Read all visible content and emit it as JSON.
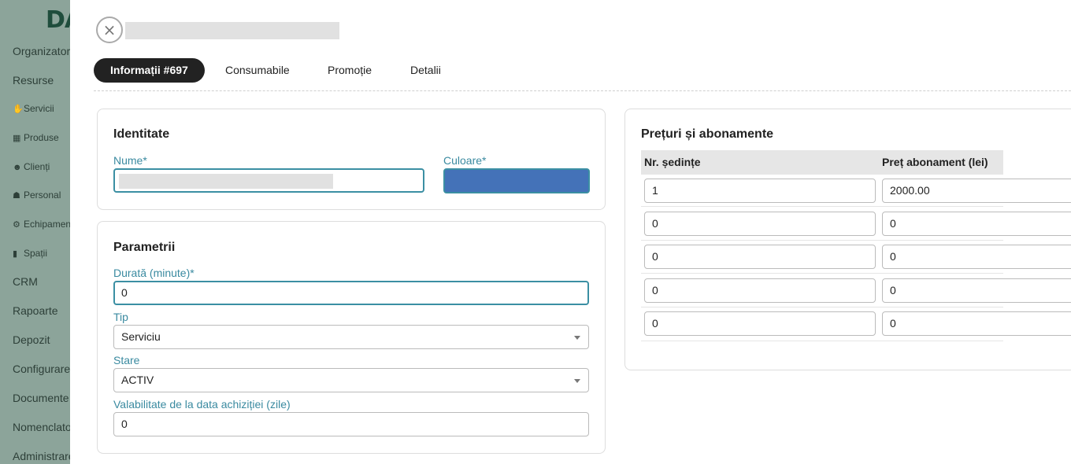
{
  "background_sidebar": {
    "logo": "DA",
    "items": [
      {
        "label": "Organizator",
        "icon": ""
      },
      {
        "label": "Resurse",
        "icon": ""
      },
      {
        "label": "Servicii",
        "icon": "hand-icon"
      },
      {
        "label": "Produse",
        "icon": "boxes-icon"
      },
      {
        "label": "Clienți",
        "icon": "users-icon"
      },
      {
        "label": "Personal",
        "icon": "staff-icon"
      },
      {
        "label": "Echipamente",
        "icon": "equipment-icon"
      },
      {
        "label": "Spații",
        "icon": "door-icon"
      },
      {
        "label": "CRM",
        "icon": ""
      },
      {
        "label": "Rapoarte",
        "icon": ""
      },
      {
        "label": "Depozit",
        "icon": ""
      },
      {
        "label": "Configurare",
        "icon": ""
      },
      {
        "label": "Documente",
        "icon": ""
      },
      {
        "label": "Nomenclatoare",
        "icon": ""
      },
      {
        "label": "Administrare",
        "icon": ""
      }
    ]
  },
  "modal": {
    "close_icon": "×",
    "tabs": [
      {
        "label": "Informații #697",
        "active": true
      },
      {
        "label": "Consumabile",
        "active": false
      },
      {
        "label": "Promoție",
        "active": false
      },
      {
        "label": "Detalii",
        "active": false
      }
    ],
    "identity": {
      "title": "Identitate",
      "name_label": "Nume*",
      "name_value": "",
      "color_label": "Culoare*",
      "color_value": "#4472b8"
    },
    "params": {
      "title": "Parametrii",
      "duration_label": "Durată (minute)*",
      "duration_value": "0",
      "type_label": "Tip",
      "type_value": "Serviciu",
      "status_label": "Stare",
      "status_value": "ACTIV",
      "validity_label": "Valabilitate de la data achiziției (zile)",
      "validity_value": "0"
    },
    "prices": {
      "title": "Prețuri și abonamente",
      "columns": [
        "Nr. ședințe",
        "Preț abonament (lei)"
      ],
      "rows": [
        {
          "sessions": "1",
          "price": "2000.00"
        },
        {
          "sessions": "0",
          "price": "0"
        },
        {
          "sessions": "0",
          "price": "0"
        },
        {
          "sessions": "0",
          "price": "0"
        },
        {
          "sessions": "0",
          "price": "0"
        }
      ]
    }
  },
  "colors": {
    "accent": "#3b8fa3",
    "label": "#3a8aa0",
    "active_tab": "#222222",
    "swatch": "#4472b8"
  }
}
